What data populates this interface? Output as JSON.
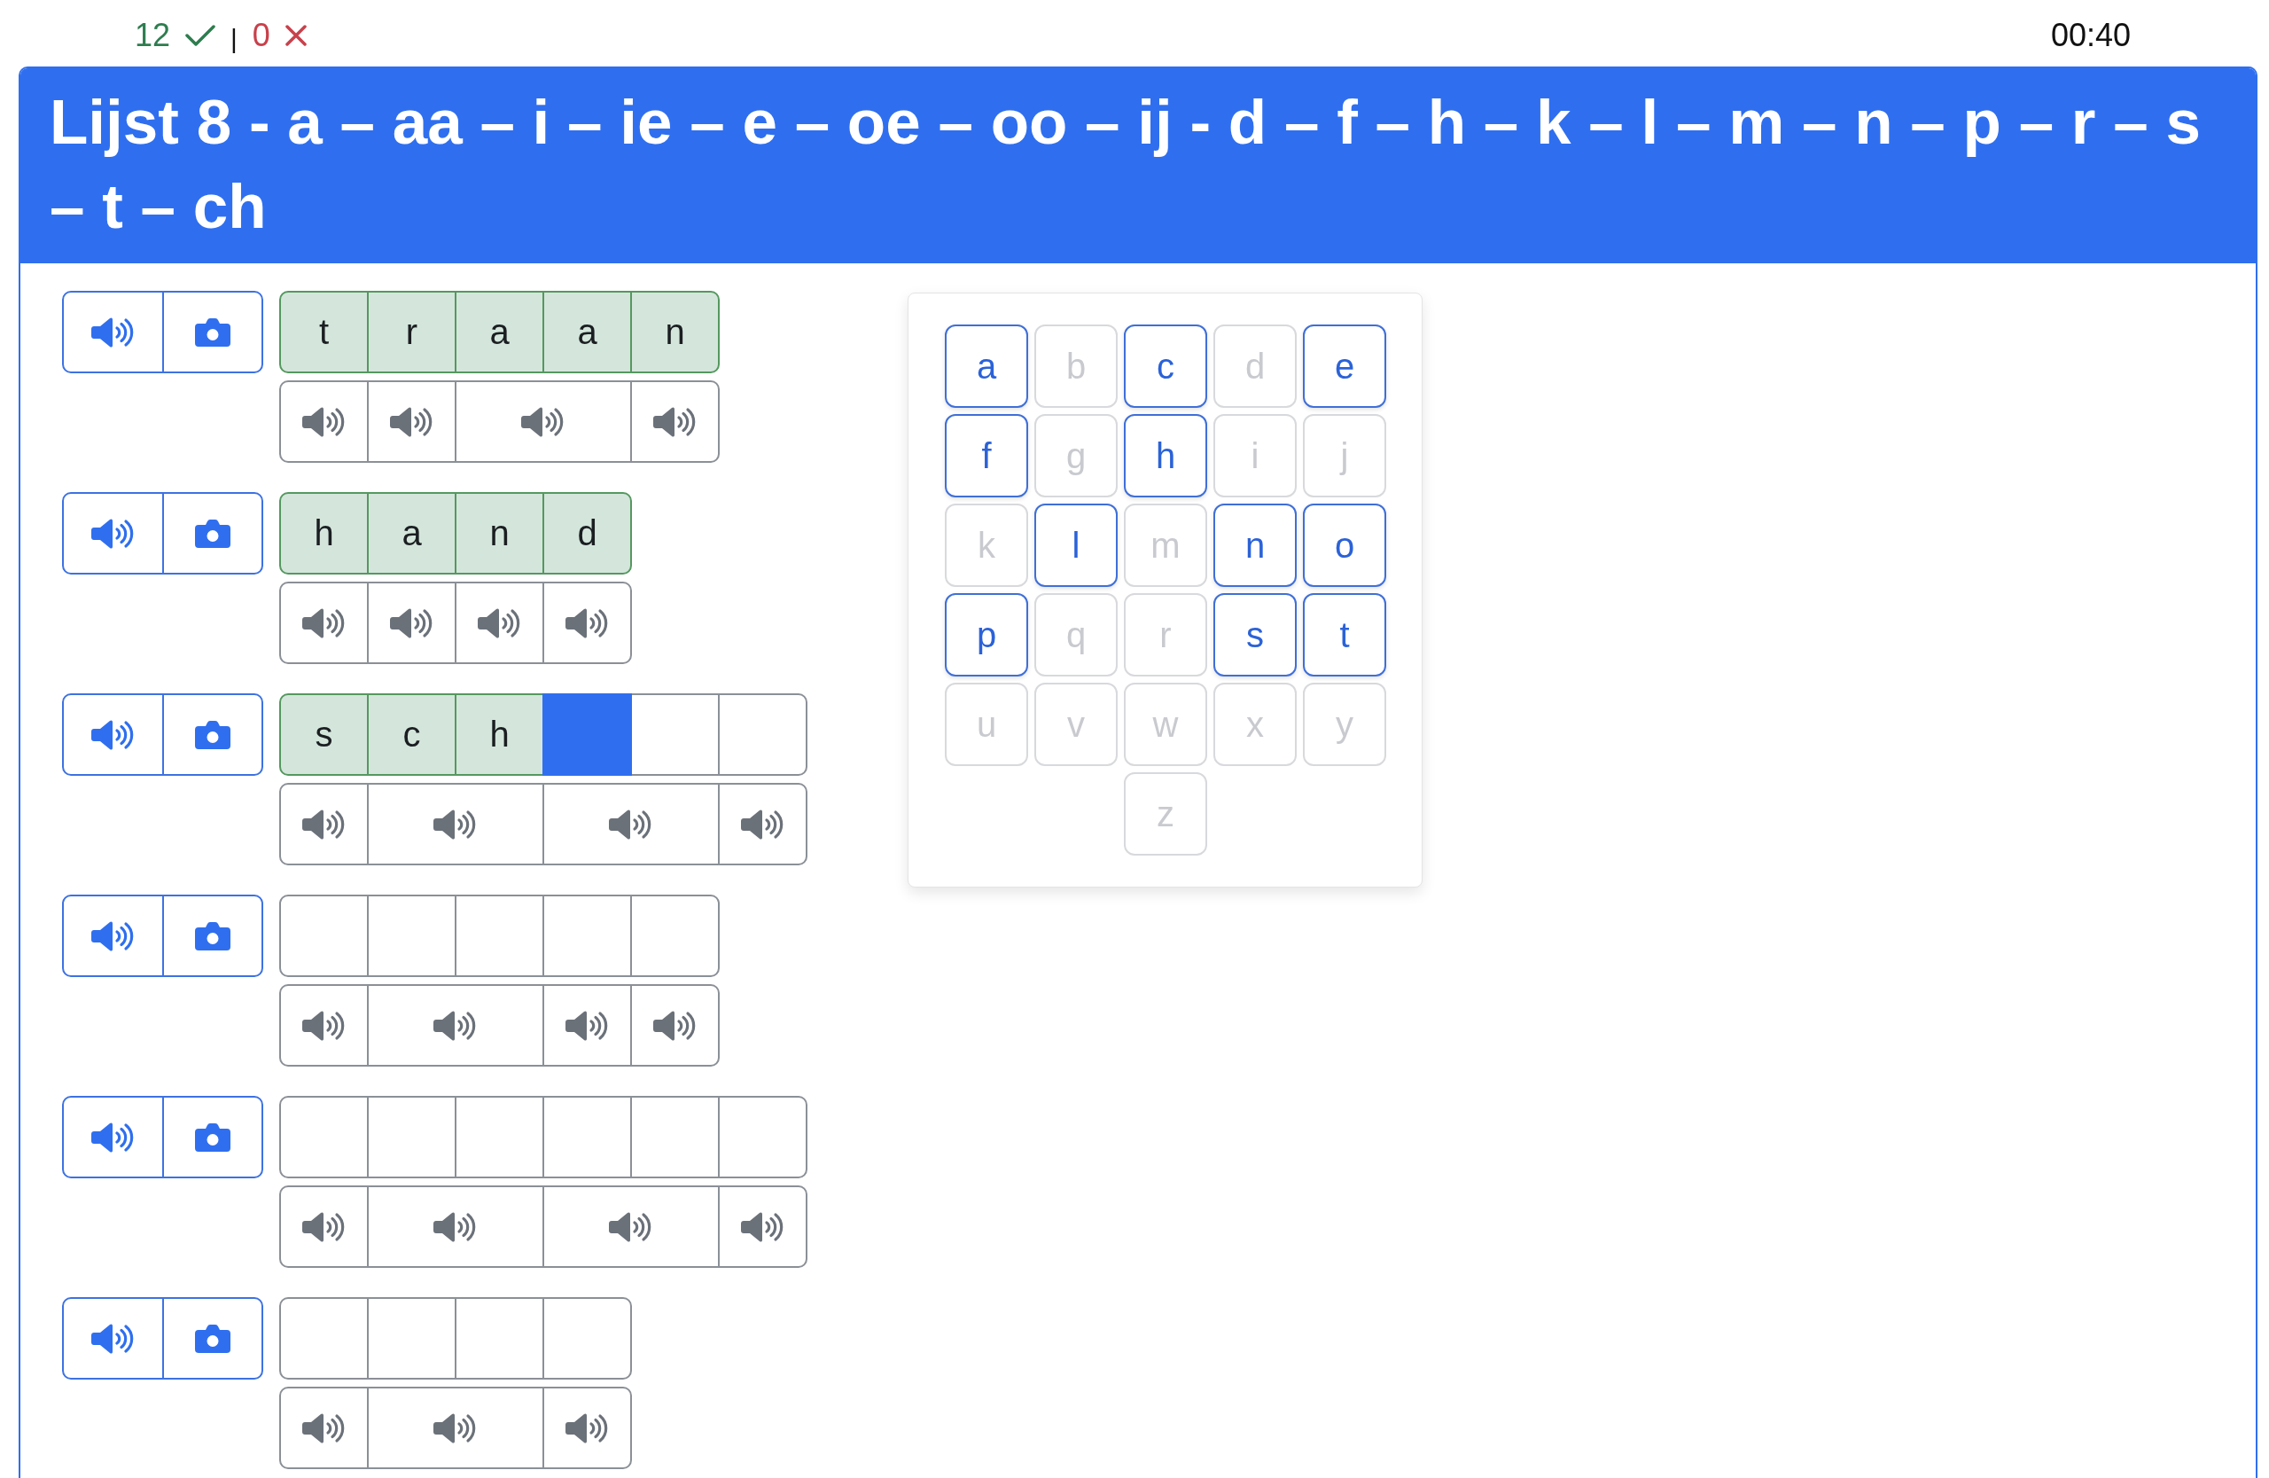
{
  "status": {
    "correct_count": "12",
    "separator": "|",
    "wrong_count": "0",
    "timer": "00:40"
  },
  "header": {
    "title": "Lijst 8 - a – aa – i – ie – e – oe – oo – ij - d – f – h – k – l – m – n – p – r – s – t – ch"
  },
  "words": [
    {
      "letters": [
        {
          "letter": "t",
          "correct": true,
          "active": false
        },
        {
          "letter": "r",
          "correct": true,
          "active": false
        },
        {
          "letter": "a",
          "correct": true,
          "active": false
        },
        {
          "letter": "a",
          "correct": true,
          "active": false
        },
        {
          "letter": "n",
          "correct": true,
          "active": false
        }
      ],
      "sounds": [
        {
          "kind": "single"
        },
        {
          "kind": "single"
        },
        {
          "kind": "double"
        },
        {
          "kind": "single"
        }
      ]
    },
    {
      "letters": [
        {
          "letter": "h",
          "correct": true,
          "active": false
        },
        {
          "letter": "a",
          "correct": true,
          "active": false
        },
        {
          "letter": "n",
          "correct": true,
          "active": false
        },
        {
          "letter": "d",
          "correct": true,
          "active": false
        }
      ],
      "sounds": [
        {
          "kind": "single"
        },
        {
          "kind": "single"
        },
        {
          "kind": "single"
        },
        {
          "kind": "single"
        }
      ]
    },
    {
      "letters": [
        {
          "letter": "s",
          "correct": true,
          "active": false
        },
        {
          "letter": "c",
          "correct": true,
          "active": false
        },
        {
          "letter": "h",
          "correct": true,
          "active": false
        },
        {
          "correct": false,
          "active": true
        },
        {
          "correct": false,
          "active": false
        },
        {
          "correct": false,
          "active": false
        }
      ],
      "sounds": [
        {
          "kind": "single"
        },
        {
          "kind": "double"
        },
        {
          "kind": "double"
        },
        {
          "kind": "single"
        }
      ]
    },
    {
      "letters": [
        {
          "correct": false,
          "active": false
        },
        {
          "correct": false,
          "active": false
        },
        {
          "correct": false,
          "active": false
        },
        {
          "correct": false,
          "active": false
        },
        {
          "correct": false,
          "active": false
        }
      ],
      "sounds": [
        {
          "kind": "single"
        },
        {
          "kind": "double"
        },
        {
          "kind": "single"
        },
        {
          "kind": "single"
        }
      ]
    },
    {
      "letters": [
        {
          "correct": false,
          "active": false
        },
        {
          "correct": false,
          "active": false
        },
        {
          "correct": false,
          "active": false
        },
        {
          "correct": false,
          "active": false
        },
        {
          "correct": false,
          "active": false
        },
        {
          "correct": false,
          "active": false
        }
      ],
      "sounds": [
        {
          "kind": "single"
        },
        {
          "kind": "double"
        },
        {
          "kind": "double"
        },
        {
          "kind": "single"
        }
      ]
    },
    {
      "letters": [
        {
          "correct": false,
          "active": false
        },
        {
          "correct": false,
          "active": false
        },
        {
          "correct": false,
          "active": false
        },
        {
          "correct": false,
          "active": false
        }
      ],
      "sounds": [
        {
          "kind": "single"
        },
        {
          "kind": "double"
        },
        {
          "kind": "single"
        }
      ]
    }
  ],
  "keyboard": {
    "keys": [
      {
        "label": "a",
        "disabled": false
      },
      {
        "label": "b",
        "disabled": true
      },
      {
        "label": "c",
        "disabled": false
      },
      {
        "label": "d",
        "disabled": true
      },
      {
        "label": "e",
        "disabled": false
      },
      {
        "label": "f",
        "disabled": false
      },
      {
        "label": "g",
        "disabled": true
      },
      {
        "label": "h",
        "disabled": false
      },
      {
        "label": "i",
        "disabled": true
      },
      {
        "label": "j",
        "disabled": true
      },
      {
        "label": "k",
        "disabled": true
      },
      {
        "label": "l",
        "disabled": false
      },
      {
        "label": "m",
        "disabled": true
      },
      {
        "label": "n",
        "disabled": false
      },
      {
        "label": "o",
        "disabled": false
      },
      {
        "label": "p",
        "disabled": false
      },
      {
        "label": "q",
        "disabled": true
      },
      {
        "label": "r",
        "disabled": true
      },
      {
        "label": "s",
        "disabled": false
      },
      {
        "label": "t",
        "disabled": false
      },
      {
        "label": "u",
        "disabled": true
      },
      {
        "label": "v",
        "disabled": true
      },
      {
        "label": "w",
        "disabled": true
      },
      {
        "label": "x",
        "disabled": true
      },
      {
        "label": "y",
        "disabled": true
      },
      {
        "label": "z",
        "disabled": true
      }
    ]
  }
}
